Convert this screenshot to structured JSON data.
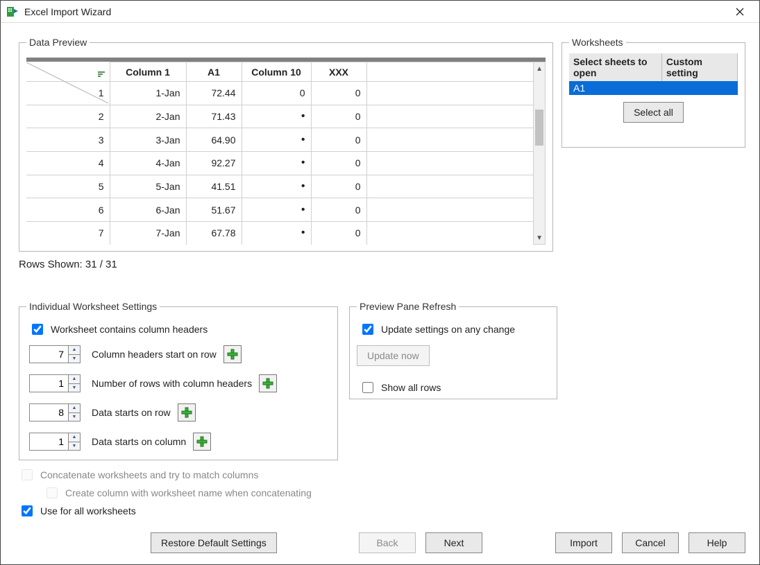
{
  "window": {
    "title": "Excel Import Wizard"
  },
  "dataPreview": {
    "legend": "Data Preview",
    "columns": [
      "Column 1",
      "A1",
      "Column 10",
      "XXX",
      ""
    ],
    "rows": [
      {
        "n": "1",
        "c1": "1-Jan",
        "a1": "72.44",
        "c10": "0",
        "xxx": "0"
      },
      {
        "n": "2",
        "c1": "2-Jan",
        "a1": "71.43",
        "c10": "•",
        "xxx": "0"
      },
      {
        "n": "3",
        "c1": "3-Jan",
        "a1": "64.90",
        "c10": "•",
        "xxx": "0"
      },
      {
        "n": "4",
        "c1": "4-Jan",
        "a1": "92.27",
        "c10": "•",
        "xxx": "0"
      },
      {
        "n": "5",
        "c1": "5-Jan",
        "a1": "41.51",
        "c10": "•",
        "xxx": "0"
      },
      {
        "n": "6",
        "c1": "6-Jan",
        "a1": "51.67",
        "c10": "•",
        "xxx": "0"
      },
      {
        "n": "7",
        "c1": "7-Jan",
        "a1": "67.78",
        "c10": "•",
        "xxx": "0"
      }
    ],
    "rowsShown": "Rows Shown: 31 / 31"
  },
  "worksheets": {
    "legend": "Worksheets",
    "col1": "Select sheets to open",
    "col2": "Custom setting",
    "rows": [
      {
        "name": "A1",
        "custom": ""
      }
    ],
    "selectAll": "Select all"
  },
  "iws": {
    "legend": "Individual Worksheet Settings",
    "hasHeaders": "Worksheet contains column headers",
    "headersStart": {
      "value": "7",
      "label": "Column headers start on row"
    },
    "numHeaderRows": {
      "value": "1",
      "label": "Number of rows with column headers"
    },
    "dataRow": {
      "value": "8",
      "label": "Data starts on row"
    },
    "dataCol": {
      "value": "1",
      "label": "Data starts on column"
    }
  },
  "ppr": {
    "legend": "Preview Pane Refresh",
    "updateAny": "Update settings on any change",
    "updateNow": "Update now",
    "showAll": "Show all rows"
  },
  "extra": {
    "concat": "Concatenate worksheets and try to match columns",
    "createCol": "Create column with worksheet name when concatenating",
    "useAll": "Use for all worksheets"
  },
  "buttons": {
    "restore": "Restore Default Settings",
    "back": "Back",
    "next": "Next",
    "import": "Import",
    "cancel": "Cancel",
    "help": "Help"
  }
}
